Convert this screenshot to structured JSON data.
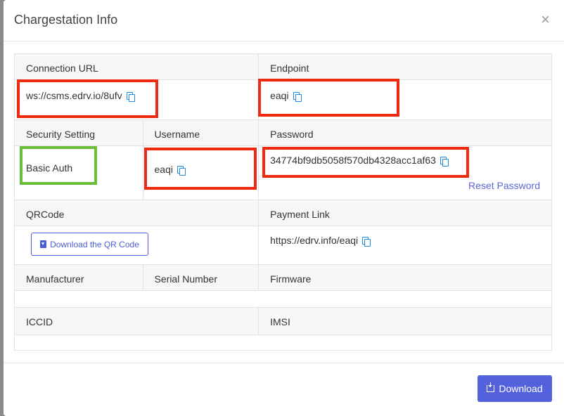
{
  "modal": {
    "title": "Chargestation Info",
    "close": "×"
  },
  "connection": {
    "url_label": "Connection URL",
    "url_value": "ws://csms.edrv.io/8ufv",
    "endpoint_label": "Endpoint",
    "endpoint_value": "eaqi"
  },
  "security": {
    "setting_label": "Security Setting",
    "setting_value": "Basic Auth",
    "username_label": "Username",
    "username_value": "eaqi",
    "password_label": "Password",
    "password_value": "34774bf9db5058f570db4328acc1af63",
    "reset_link": "Reset Password"
  },
  "qr": {
    "label": "QRCode",
    "button": "Download the QR Code"
  },
  "payment": {
    "label": "Payment Link",
    "value": "https://edrv.info/eaqi"
  },
  "hardware": {
    "manufacturer_label": "Manufacturer",
    "serial_label": "Serial Number",
    "firmware_label": "Firmware"
  },
  "sim": {
    "iccid_label": "ICCID",
    "imsi_label": "IMSI"
  },
  "footer": {
    "download_button": "Download"
  },
  "colors": {
    "accent": "#5461dc",
    "copy_icon": "#1e88e5",
    "highlight_red": "#ee2a10",
    "highlight_green": "#6cbe3a"
  },
  "icons": [
    "copy-icon",
    "download-icon",
    "close-icon"
  ]
}
